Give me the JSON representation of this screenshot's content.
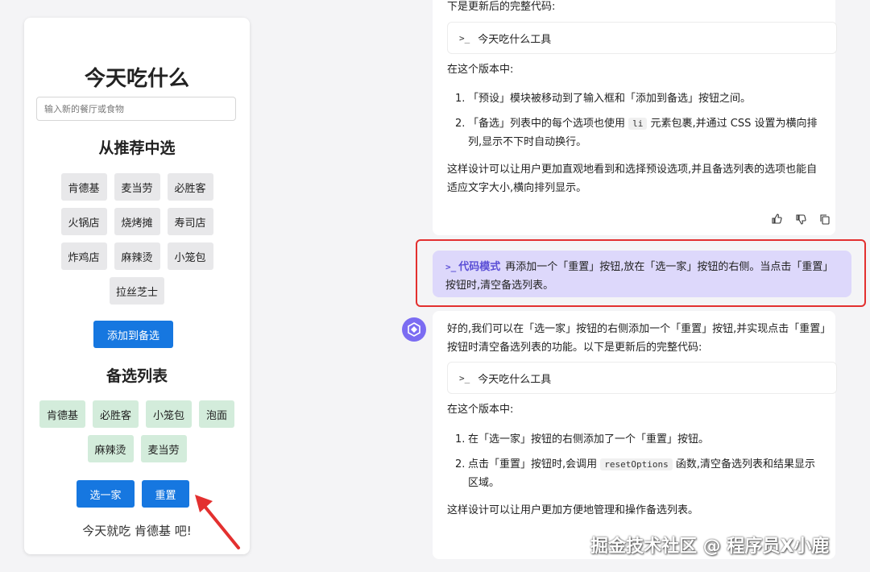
{
  "app": {
    "title": "今天吃什么",
    "input_placeholder": "输入新的餐厅或食物",
    "presets_title": "从推荐中选",
    "presets": [
      "肯德基",
      "麦当劳",
      "必胜客",
      "火锅店",
      "烧烤摊",
      "寿司店",
      "炸鸡店",
      "麻辣烫",
      "小笼包",
      "拉丝芝士"
    ],
    "add_button": "添加到备选",
    "selected_title": "备选列表",
    "selected": [
      "肯德基",
      "必胜客",
      "小笼包",
      "泡面",
      "麻辣烫",
      "麦当劳"
    ],
    "pick_button": "选一家",
    "reset_button": "重置",
    "result": "今天就吃 肯德基 吧!"
  },
  "chat": {
    "top": {
      "intro": "下是更新后的完整代码:",
      "code_prompt": ">_",
      "code_title": "今天吃什么工具",
      "version_heading": "在这个版本中:",
      "items": [
        {
          "num": "1.",
          "text": "「预设」模块被移动到了输入框和「添加到备选」按钮之间。"
        },
        {
          "num": "2.",
          "pre": "「备选」列表中的每个选项也使用",
          "code": "li",
          "post": "元素包裹,并通过 CSS 设置为横向排列,显示不下时自动换行。"
        }
      ],
      "summary": "这样设计可以让用户更加直观地看到和选择预设选项,并且备选列表的选项也能自适应文字大小,横向排列显示。"
    },
    "user_message": {
      "mode_prompt": ">_",
      "mode_label": "代码模式",
      "text": "再添加一个「重置」按钮,放在「选一家」按钮的右侧。当点击「重置」按钮时,清空备选列表。"
    },
    "bottom": {
      "intro": "好的,我们可以在「选一家」按钮的右侧添加一个「重置」按钮,并实现点击「重置」按钮时清空备选列表的功能。以下是更新后的完整代码:",
      "code_prompt": ">_",
      "code_title": "今天吃什么工具",
      "version_heading": "在这个版本中:",
      "items": [
        {
          "num": "1.",
          "text": "在「选一家」按钮的右侧添加了一个「重置」按钮。"
        },
        {
          "num": "2.",
          "pre": "点击「重置」按钮时,会调用",
          "code": "resetOptions",
          "post": "函数,清空备选列表和结果显示区域。"
        }
      ],
      "summary": "这样设计可以让用户更加方便地管理和操作备选列表。"
    }
  },
  "watermark": "掘金技术社区 @ 程序员X小鹿",
  "colors": {
    "accent_blue": "#1677e0",
    "selected_chip": "#d3ecdb",
    "user_bubble": "#ddd8fb",
    "highlight_red": "#e3302f",
    "mode_purple": "#5b4fd6"
  }
}
